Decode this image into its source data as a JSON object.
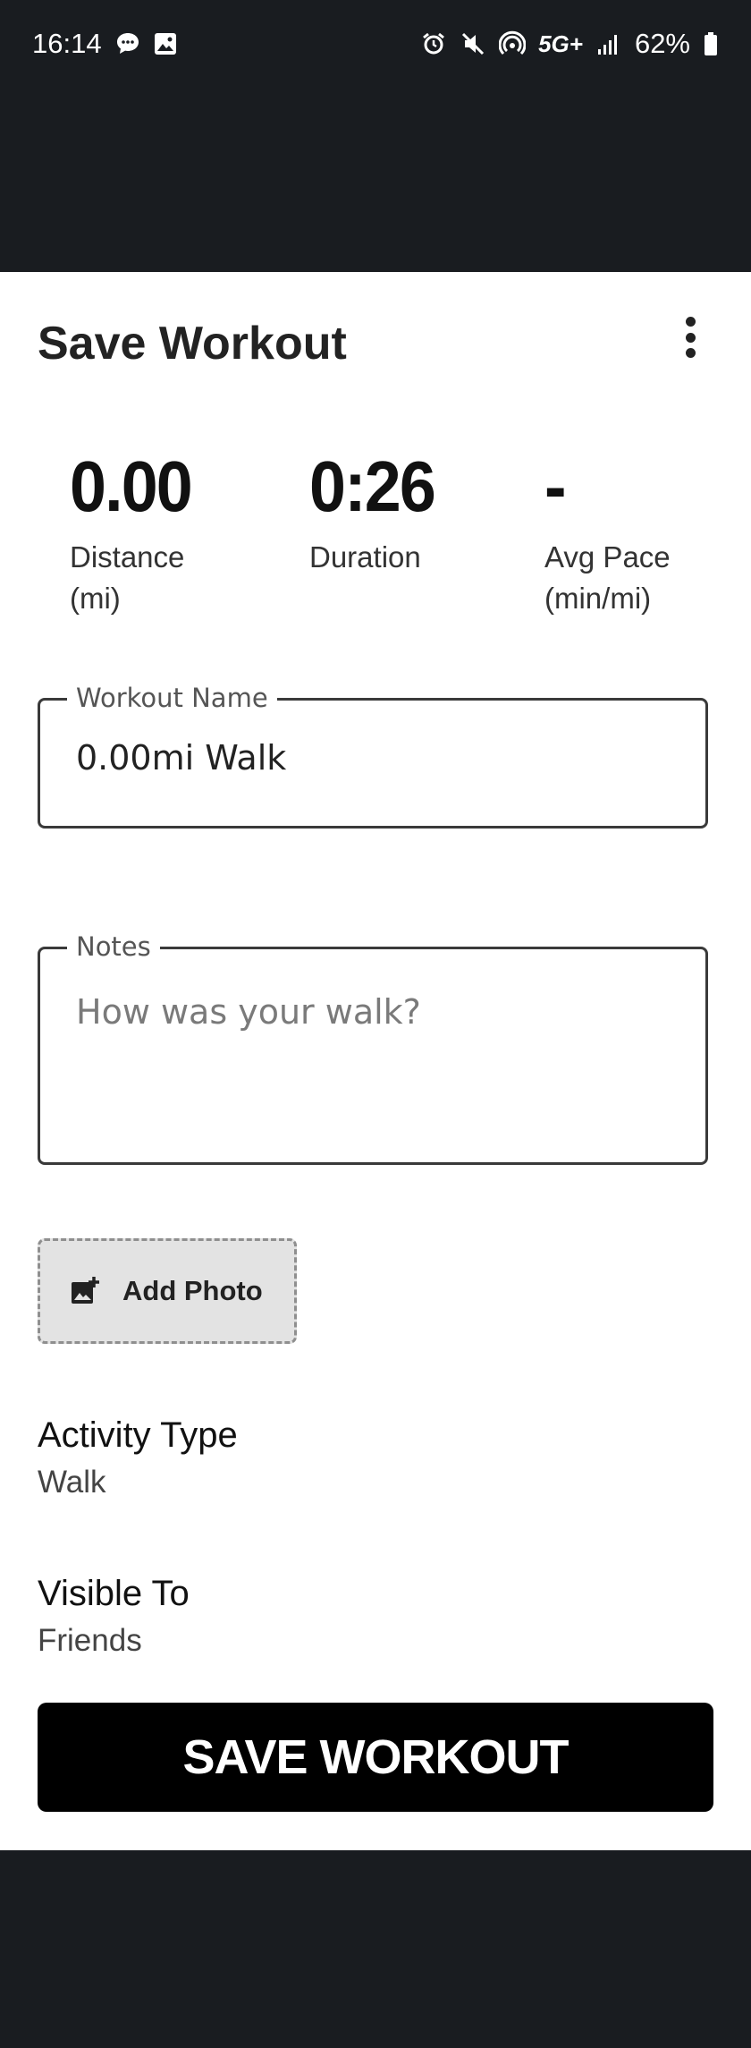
{
  "status_bar": {
    "time": "16:14",
    "battery": "62%",
    "network": "5G+",
    "left_icons": [
      "message-icon",
      "image-icon"
    ],
    "right_icons": [
      "alarm-icon",
      "mute-icon",
      "hotspot-icon",
      "network-icon",
      "signal-icon",
      "battery-icon"
    ]
  },
  "header": {
    "title": "Save Workout"
  },
  "stats": [
    {
      "value": "0.00",
      "label": "Distance (mi)"
    },
    {
      "value": "0:26",
      "label": "Duration"
    },
    {
      "value": "-",
      "label": "Avg Pace (min/mi)"
    }
  ],
  "workout_name": {
    "label": "Workout Name",
    "value": "0.00mi Walk"
  },
  "notes": {
    "label": "Notes",
    "placeholder": "How was your walk?"
  },
  "add_photo": {
    "label": "Add Photo"
  },
  "settings": {
    "activity_type": {
      "title": "Activity Type",
      "value": "Walk"
    },
    "visible_to": {
      "title": "Visible To",
      "value": "Friends"
    }
  },
  "save_button": {
    "label": "SAVE WORKOUT"
  }
}
